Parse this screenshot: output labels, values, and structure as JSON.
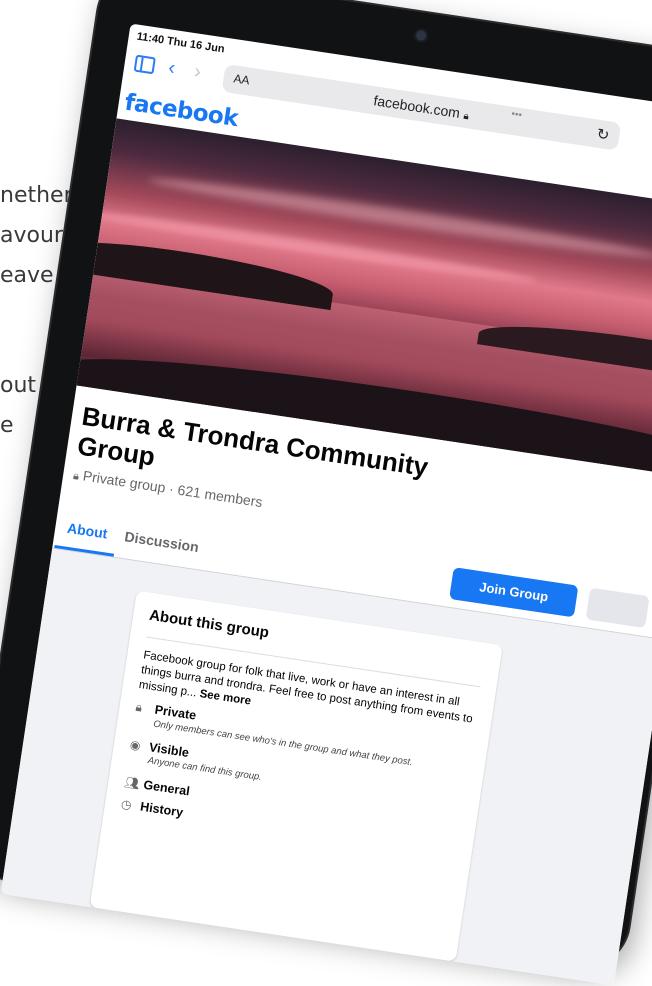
{
  "side_text": {
    "block1": [
      "nether",
      "avour",
      "eave"
    ],
    "block2": [
      "out",
      "e"
    ]
  },
  "status_bar": {
    "time_date": "11:40  Thu 16 Jun"
  },
  "browser": {
    "text_size_label": "AA",
    "more_indicator": "•••",
    "url": "facebook.com",
    "icons": [
      "sidebar-icon",
      "back-icon",
      "forward-icon",
      "lock-icon",
      "reload-icon"
    ]
  },
  "facebook": {
    "logo": "facebook",
    "brand_color": "#1877f2",
    "group": {
      "name": "Burra & Trondra Community Group",
      "meta": "Private group · 621 members"
    },
    "tabs": [
      {
        "label": "About",
        "active": true
      },
      {
        "label": "Discussion",
        "active": false
      }
    ],
    "join_label": "Join Group",
    "about": {
      "title": "About this group",
      "description": "Facebook group for folk that live, work or have an interest in all things burra and trondra. Feel free to post anything from events to missing p...",
      "see_more": "See more",
      "items": [
        {
          "icon": "lock-icon",
          "label": "Private",
          "sub": "Only members can see who's in the group and what they post."
        },
        {
          "icon": "eye-icon",
          "label": "Visible",
          "sub": "Anyone can find this group."
        },
        {
          "icon": "people-icon",
          "label": "General",
          "sub": ""
        },
        {
          "icon": "clock-icon",
          "label": "History",
          "sub": ""
        }
      ]
    }
  }
}
